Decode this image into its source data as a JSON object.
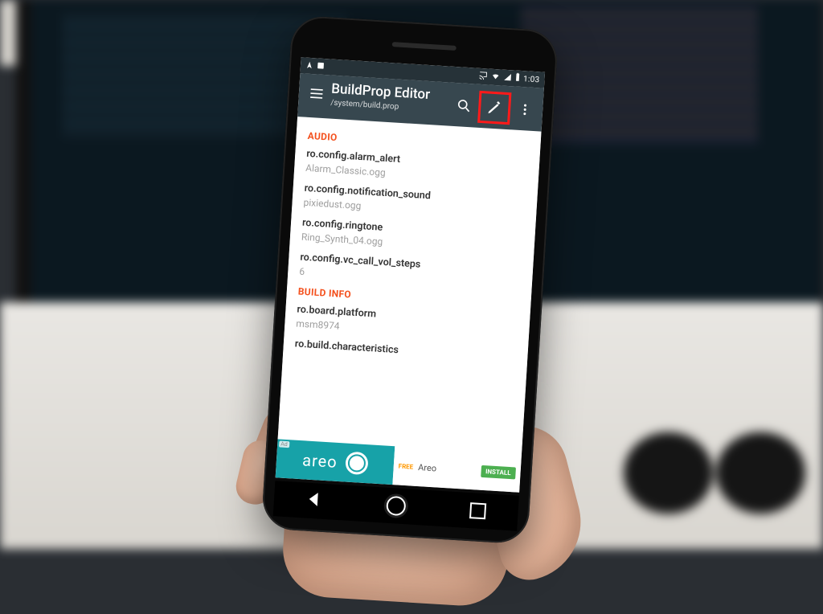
{
  "statusbar": {
    "time": "1:03",
    "icons": [
      "location-icon",
      "gallery-icon",
      "cast-icon",
      "wifi-icon",
      "signal-icon",
      "battery-icon"
    ]
  },
  "appbar": {
    "title": "BuildProp Editor",
    "subtitle": "/system/build.prop"
  },
  "sections": [
    {
      "title": "AUDIO",
      "props": [
        {
          "key": "ro.config.alarm_alert",
          "value": "Alarm_Classic.ogg"
        },
        {
          "key": "ro.config.notification_sound",
          "value": "pixiedust.ogg"
        },
        {
          "key": "ro.config.ringtone",
          "value": "Ring_Synth_04.ogg"
        },
        {
          "key": "ro.config.vc_call_vol_steps",
          "value": "6"
        }
      ]
    },
    {
      "title": "BUILD INFO",
      "props": [
        {
          "key": "ro.board.platform",
          "value": "msm8974"
        },
        {
          "key": "ro.build.characteristics",
          "value": ""
        }
      ]
    }
  ],
  "ad": {
    "brand": "areo",
    "app_name": "Areo",
    "price_tag": "FREE",
    "cta": "INSTALL",
    "badge": "Ad"
  }
}
